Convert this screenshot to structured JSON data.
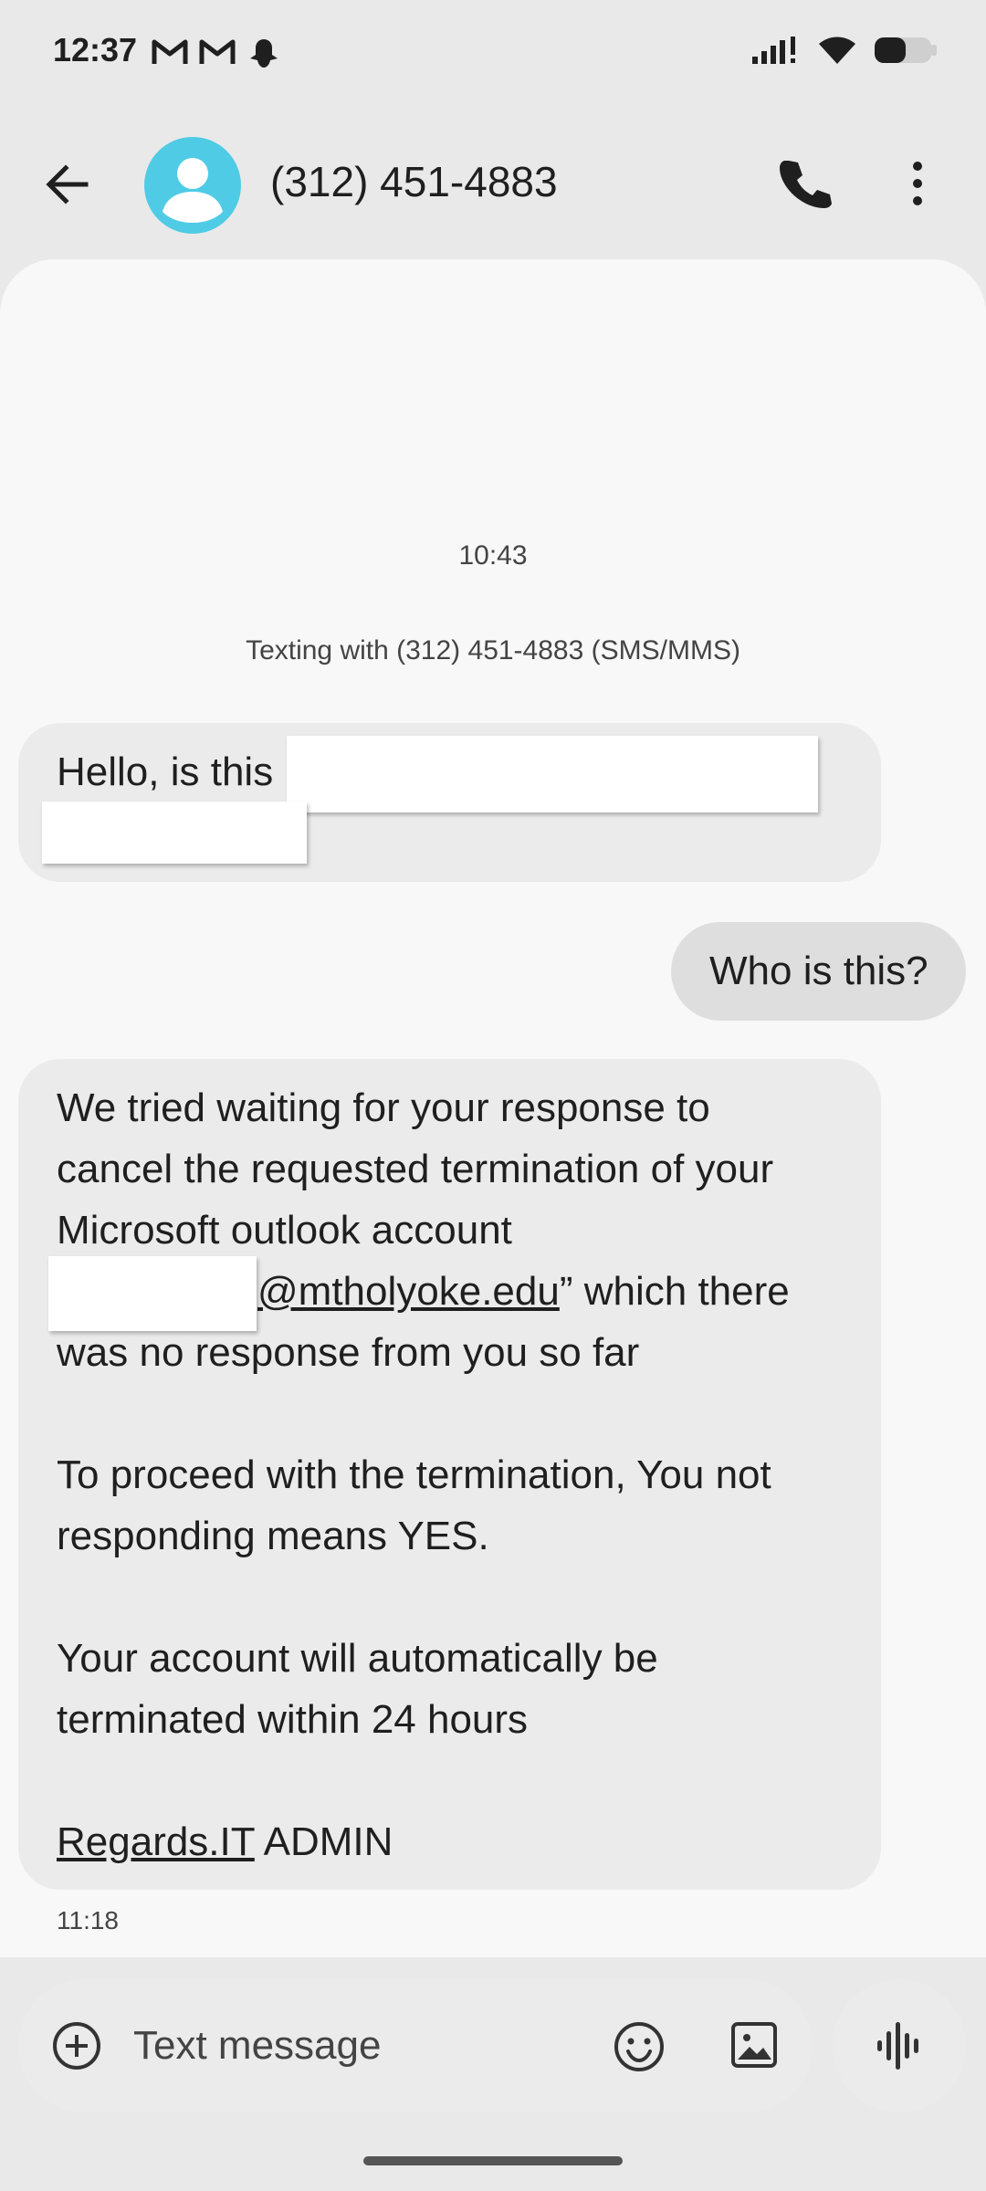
{
  "status_bar": {
    "time": "12:37",
    "left_icons": [
      "gmail-icon",
      "gmail-icon",
      "notification-icon"
    ],
    "right_icons": [
      "signal-icon",
      "wifi-icon",
      "battery-icon"
    ]
  },
  "header": {
    "title": "(312) 451-4883",
    "icons": [
      "back-arrow-icon",
      "contact-avatar-icon",
      "phone-icon",
      "more-vert-icon"
    ]
  },
  "conversation": {
    "date_time": "10:43",
    "texting_with": "Texting with (312) 451-4883 (SMS/MMS)",
    "messages": [
      {
        "direction": "incoming",
        "text": "Hello, is this"
      },
      {
        "direction": "outgoing",
        "text": "Who is this?"
      },
      {
        "direction": "incoming",
        "lines": [
          "We tried waiting for your response to",
          "cancel the requested termination of your",
          "Microsoft outlook account",
          "@mtholyoke.edu",
          "” which there",
          "was no response from you so far",
          "To proceed with the termination, You not",
          "responding means YES.",
          "Your account will automatically be",
          "terminated within 24 hours",
          "Regards.IT",
          " ADMIN"
        ],
        "time": "11:18"
      }
    ]
  },
  "compose": {
    "placeholder": "Text message",
    "icons": [
      "add-circle-icon",
      "emoji-icon",
      "gallery-icon",
      "voice-icon"
    ]
  },
  "colors": {
    "avatar": "#4fcbe5",
    "background": "#e9e9e9",
    "conversation_bg": "#f8f8f8",
    "bubble_incoming": "#ebebeb",
    "bubble_outgoing": "#dedede"
  }
}
